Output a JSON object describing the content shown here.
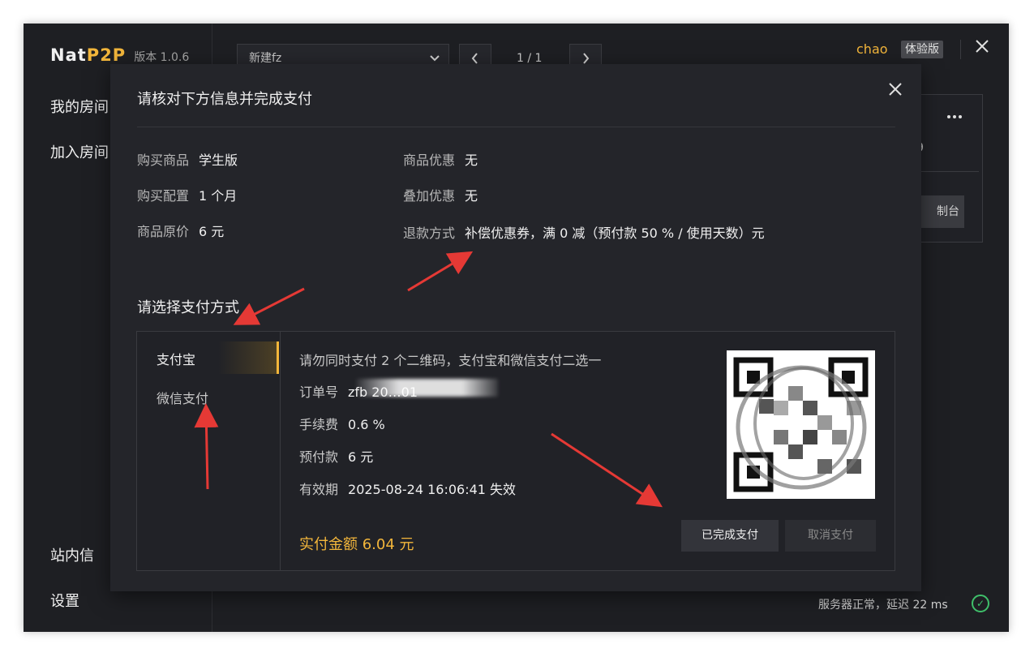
{
  "app": {
    "brand_name": "Nat",
    "brand_accent": "P2P",
    "version": "版本 1.0.6",
    "nav": [
      "我的房间",
      "加入房间"
    ],
    "nav_bottom": [
      "站内信",
      "设置"
    ],
    "room_select": "新建fz",
    "pager": "1 / 1",
    "user": "chao",
    "badge": "体验版",
    "card_fragment": "9",
    "card_button": "制台",
    "status": "服务器正常，延迟 22 ms"
  },
  "modal": {
    "title": "请核对下方信息并完成支付",
    "left_fields": [
      {
        "k": "购买商品",
        "v": "学生版"
      },
      {
        "k": "购买配置",
        "v": "1 个月"
      },
      {
        "k": "商品原价",
        "v": "6 元"
      }
    ],
    "right_fields": [
      {
        "k": "商品优惠",
        "v": "无"
      },
      {
        "k": "叠加优惠",
        "v": "无"
      },
      {
        "k": "退款方式",
        "v": "补偿优惠券，满 0 减（预付款 50 % / 使用天数）元"
      }
    ],
    "pay_section_title": "请选择支付方式",
    "pay_methods": [
      "支付宝",
      "微信支付"
    ],
    "note": "请勿同时支付 2 个二维码，支付宝和微信支付二选一",
    "order": {
      "k": "订单号",
      "v": "zfb 20…01"
    },
    "fee": {
      "k": "手续费",
      "v": "0.6 %"
    },
    "prepay": {
      "k": "预付款",
      "v": "6 元"
    },
    "expire": {
      "k": "有效期",
      "v": "2025-08-24 16:06:41 失效"
    },
    "total": "实付金额 6.04 元",
    "btn_done": "已完成支付",
    "btn_cancel": "取消支付"
  },
  "colors": {
    "accent": "#f3b63b",
    "background": "#1e1f23",
    "modal": "#24252a",
    "arrow": "#e53935",
    "ok": "#3fbf6a"
  },
  "icons": [
    "chevron-down-icon",
    "chevron-left-icon",
    "chevron-right-icon",
    "close-icon",
    "more-icon",
    "check-circle-icon"
  ]
}
